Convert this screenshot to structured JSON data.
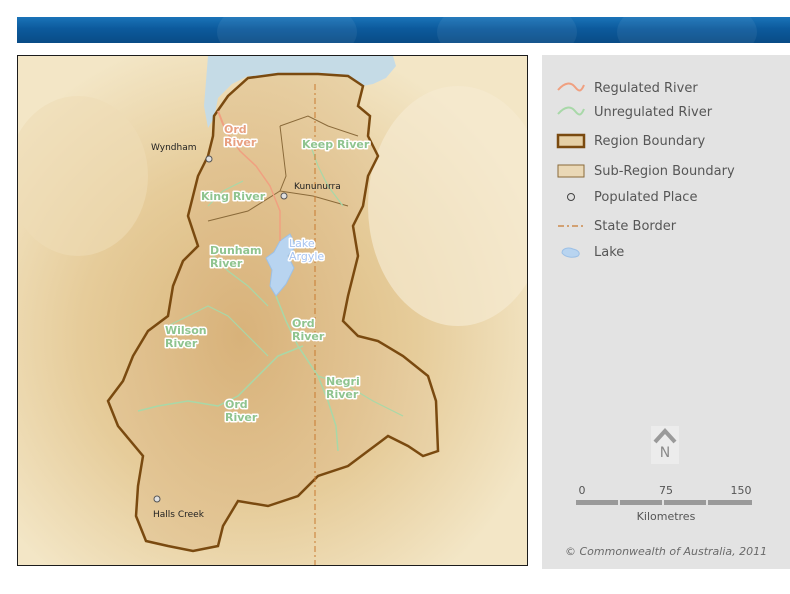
{
  "colors": {
    "region_boundary": "#7a4a10",
    "subregion_boundary": "#8a6a3a",
    "regulated_river": "#f0a080",
    "unregulated_river": "#a8d8a8",
    "state_border": "#c87a30",
    "lake": "#b8d4f0",
    "legend_bg": "#e3e3e3"
  },
  "map": {
    "river_labels": {
      "ord_north": "Ord\nRiver",
      "keep": "Keep River",
      "king": "King River",
      "dunham": "Dunham\nRiver",
      "wilson": "Wilson\nRiver",
      "ord_mid": "Ord\nRiver",
      "negri": "Negri\nRiver",
      "ord_south": "Ord\nRiver"
    },
    "lake_label": "Lake\nArgyle",
    "places": {
      "wyndham": "Wyndham",
      "kununurra": "Kununurra",
      "halls_creek": "Halls Creek"
    }
  },
  "legend": {
    "items": [
      {
        "label": "Regulated River",
        "icon": "regulated-river-icon"
      },
      {
        "label": "Unregulated River",
        "icon": "unregulated-river-icon"
      },
      {
        "label": "Region Boundary",
        "icon": "region-boundary-icon"
      },
      {
        "label": "Sub-Region Boundary",
        "icon": "subregion-boundary-icon"
      },
      {
        "label": "Populated Place",
        "icon": "populated-place-icon"
      },
      {
        "label": "State Border",
        "icon": "state-border-icon"
      },
      {
        "label": "Lake",
        "icon": "lake-icon"
      }
    ]
  },
  "north_arrow": {
    "letter": "N"
  },
  "scale_bar": {
    "ticks": [
      "0",
      "75",
      "150"
    ],
    "unit": "Kilometres"
  },
  "copyright": "© Commonwealth of Australia, 2011"
}
